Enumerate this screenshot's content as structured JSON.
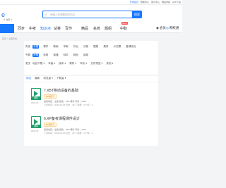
{
  "topbar": {
    "links": [
      "开通会员",
      "帮助中心",
      "用户中心",
      "网站导航",
      "APP下载"
    ],
    "highlight_index": 0
  },
  "header": {
    "logo": "e",
    "location": "北京",
    "search_placeholder": "请输入你想要找的内容",
    "search_button": "搜索"
  },
  "nav": {
    "home_label": "",
    "items": [
      "同步",
      "中考",
      "知识点",
      "试卷",
      "写作",
      "精品",
      "名校",
      "题组",
      "中职"
    ],
    "active_index": 2,
    "new_badge": "NEW",
    "right": {
      "user_label": "会员",
      "vip_label": "网校通"
    }
  },
  "breadcrumb": "首页 > 资源列表",
  "filters": {
    "rows": [
      {
        "label": "类型",
        "options": [
          "不限",
          "课件",
          "教案",
          "学案",
          "作业",
          "试卷",
          "题集",
          "素材",
          "示范课",
          "备课综合"
        ],
        "selected": 0
      },
      {
        "label": "专题",
        "options": [
          "不限",
          "免费",
          "普通",
          "特供",
          "精品",
          "组卷"
        ],
        "selected": 0
      },
      {
        "label": "更多",
        "options": [
          "地区不限",
          "年级",
          "版本",
          "教材",
          "年份",
          "文件类型",
          "其他"
        ],
        "selected": -1
      }
    ]
  },
  "sort": {
    "options": [
      "综合",
      "最新",
      "浏览量",
      "下载量"
    ],
    "selected": 0
  },
  "items": [
    {
      "title": "7.XBT移动设备的基础",
      "tag": "中考复习",
      "thumb_tag": "课件",
      "attr": "适用地区：全国  类别：PPT/课件  年份：2023",
      "meta": "上传时间：2022-02-15  点击：18  下载量：0  分享：0",
      "date": "2022-02"
    },
    {
      "title": "6.XP备考课程课件设计",
      "tag": "中考复习",
      "thumb_tag": "课件",
      "attr": "适用地区：全国  类别：PPT/课件  年份：2023",
      "meta": "上传时间：2022-02-15  点击：20  下载量：0  分享：0",
      "date": "2022-02"
    }
  ],
  "colors": {
    "accent": "#1677ff",
    "doc_green": "#22a06b",
    "tag_orange": "#d48806"
  }
}
